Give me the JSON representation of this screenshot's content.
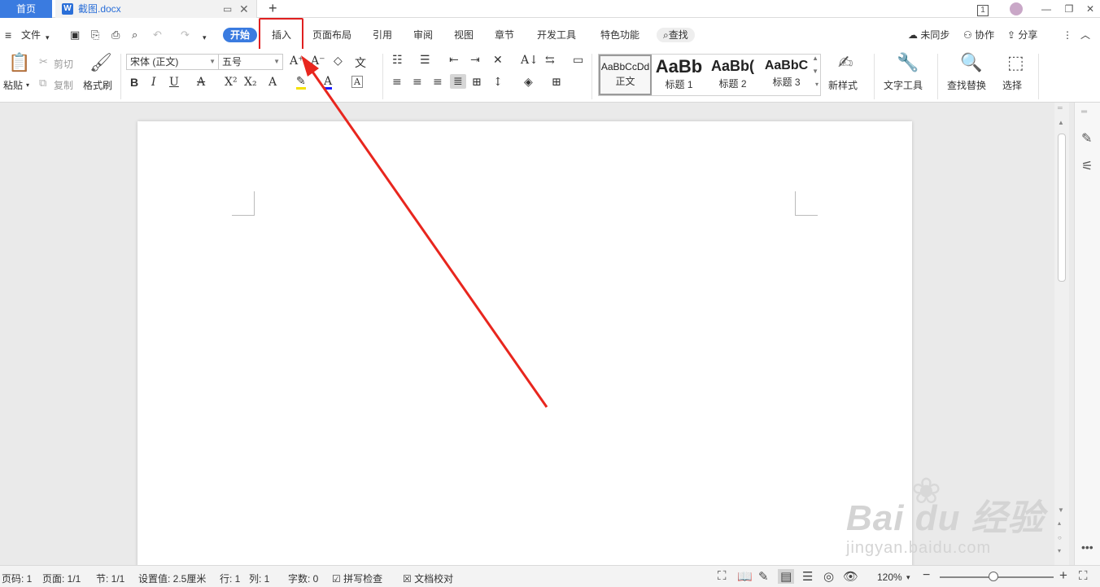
{
  "tabbar": {
    "home": "首页",
    "doc_icon": "W",
    "doc_title": "截图.docx",
    "new_tab": "+",
    "badge": "1"
  },
  "menu": {
    "file": "文件",
    "tabs": [
      "开始",
      "插入",
      "页面布局",
      "引用",
      "审阅",
      "视图",
      "章节",
      "开发工具",
      "特色功能"
    ],
    "search": "查找",
    "sync": "未同步",
    "collab": "协作",
    "share": "分享"
  },
  "ribbon": {
    "paste": "粘贴",
    "cut": "剪切",
    "copy": "复制",
    "format_painter": "格式刷",
    "font_name": "宋体 (正文)",
    "font_size": "五号",
    "styles": [
      {
        "sample": "AaBbCcDd",
        "name": "正文"
      },
      {
        "sample": "AaBb",
        "name": "标题 1"
      },
      {
        "sample": "AaBb(",
        "name": "标题 2"
      },
      {
        "sample": "AaBbC",
        "name": "标题 3"
      }
    ],
    "new_style": "新样式",
    "text_tools": "文字工具",
    "find_replace": "查找替换",
    "select": "选择"
  },
  "status": {
    "page_num": "页码: 1",
    "pages": "页面: 1/1",
    "section": "节: 1/1",
    "setting": "设置值: 2.5厘米",
    "row": "行: 1",
    "col": "列: 1",
    "wordcount": "字数: 0",
    "spell": "拼写检查",
    "proof": "文档校对",
    "zoom": "120%",
    "zoom_level_fraction": 0.47
  },
  "watermark": {
    "brand": "Bai du 经验",
    "url": "jingyan.baidu.com"
  },
  "colors": {
    "accent": "#3a7be0",
    "highlight_box": "#e02020",
    "arrow": "#e8261e"
  }
}
